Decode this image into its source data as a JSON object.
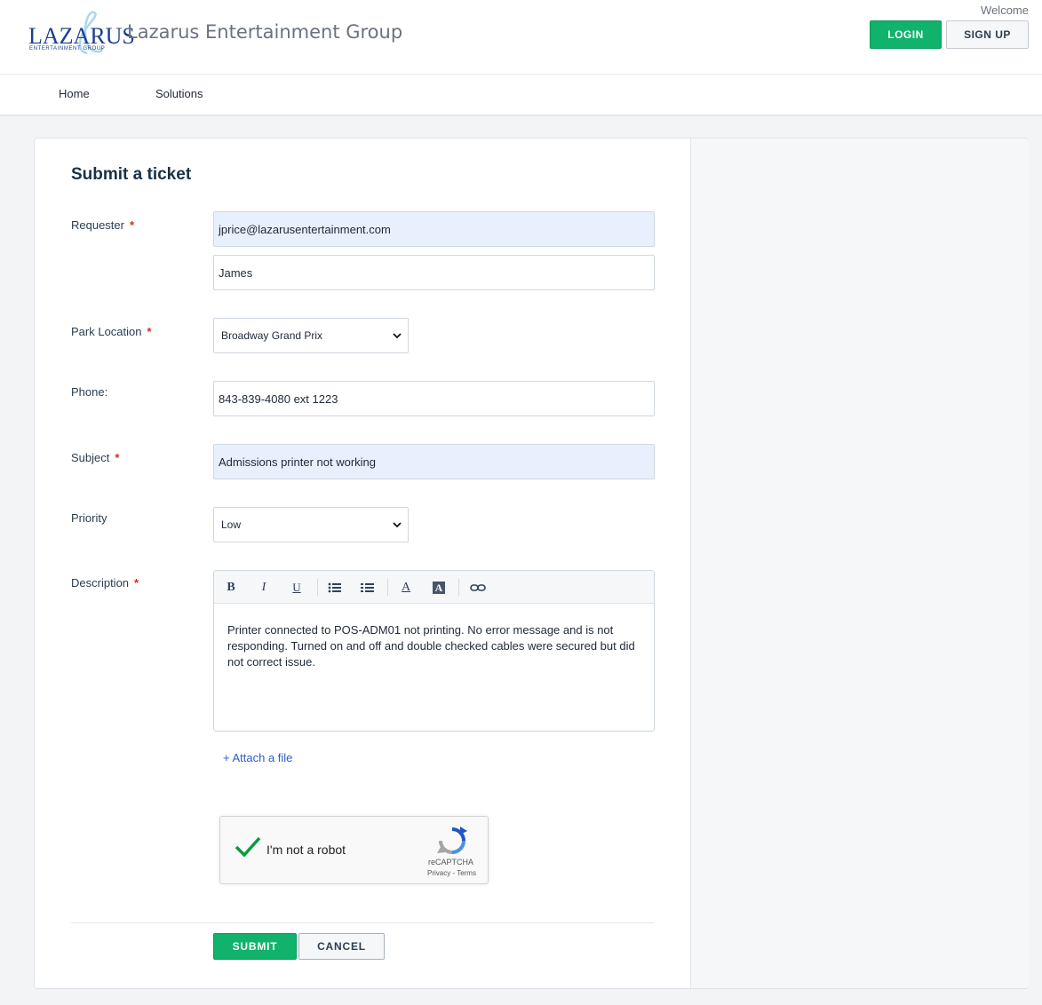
{
  "header": {
    "logo_text": "LAZARUS",
    "logo_subtext": "ENTERTAINMENT GROUP",
    "site_title": "Lazarus Entertainment Group",
    "welcome": "Welcome",
    "login_label": "LOGIN",
    "signup_label": "SIGN UP"
  },
  "nav": {
    "items": [
      {
        "label": "Home"
      },
      {
        "label": "Solutions"
      }
    ]
  },
  "form": {
    "title": "Submit a ticket",
    "requester": {
      "label": "Requester",
      "required_mark": "*",
      "email": "jprice@lazarusentertainment.com",
      "name": "James"
    },
    "park_location": {
      "label": "Park Location",
      "required_mark": "*",
      "selected": "Broadway Grand Prix"
    },
    "phone": {
      "label": "Phone:",
      "value": "843-839-4080 ext 1223"
    },
    "subject": {
      "label": "Subject",
      "required_mark": "*",
      "value": "Admissions printer not working"
    },
    "priority": {
      "label": "Priority",
      "selected": "Low"
    },
    "description": {
      "label": "Description",
      "required_mark": "*",
      "toolbar": [
        "bold-icon",
        "italic-icon",
        "underline-icon",
        "bulleted-list-icon",
        "numbered-list-icon",
        "font-color-icon",
        "background-color-icon",
        "link-icon"
      ],
      "toolbar_glyphs": {
        "bold": "B",
        "italic": "I",
        "underline": "U",
        "font_color": "A",
        "background_color": "A"
      },
      "value": "Printer connected to POS-ADM01 not printing. No error message and is not responding. Turned on and off and double checked cables were secured but did not correct issue."
    },
    "attach_label": "+ Attach a file",
    "captcha": {
      "label": "I'm not a robot",
      "brand": "reCAPTCHA",
      "links": "Privacy - Terms",
      "checked": true
    },
    "submit_label": "SUBMIT",
    "cancel_label": "CANCEL"
  },
  "colors": {
    "primary_green": "#10b26c",
    "autofill_blue": "#e8f0fe",
    "required_red": "#d52b1e",
    "link_blue": "#2c5cc5",
    "logo_blue": "#1d3f8f"
  }
}
